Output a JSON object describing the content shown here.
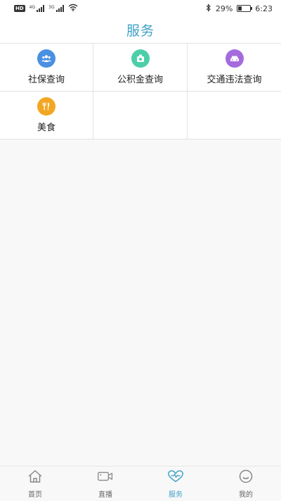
{
  "status_bar": {
    "hd_badge": "HD",
    "net1": "4G",
    "net2": "3G",
    "battery_percent": "29%",
    "battery_level": 0.29,
    "time": "6:23"
  },
  "header": {
    "title": "服务"
  },
  "services": [
    {
      "label": "社保查询",
      "icon": "people-icon",
      "color": "#4a90e2"
    },
    {
      "label": "公积金查询",
      "icon": "house-fund-icon",
      "color": "#4ccfa8"
    },
    {
      "label": "交通违法查询",
      "icon": "car-icon",
      "color": "#a56bdc"
    },
    {
      "label": "美食",
      "icon": "food-icon",
      "color": "#f2a623"
    }
  ],
  "bottom_nav": {
    "items": [
      {
        "label": "首页",
        "icon": "home-icon"
      },
      {
        "label": "直播",
        "icon": "video-camera-icon"
      },
      {
        "label": "服务",
        "icon": "heart-icon"
      },
      {
        "label": "我的",
        "icon": "smiley-icon"
      }
    ],
    "active_index": 2,
    "active_color": "#3ea1c6"
  }
}
